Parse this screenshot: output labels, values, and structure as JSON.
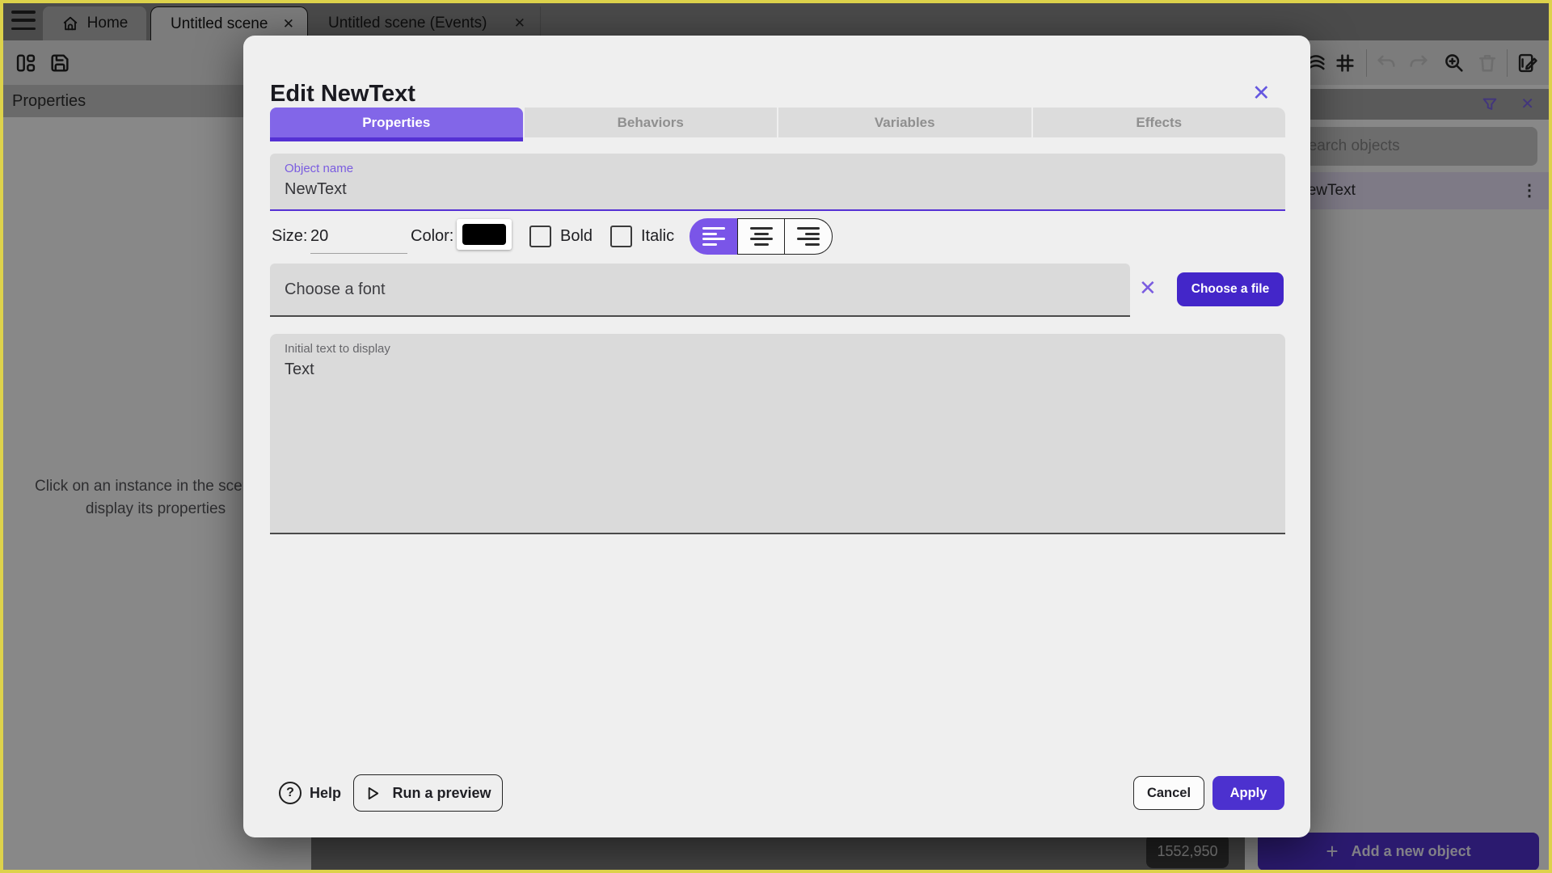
{
  "window": {
    "tabs": [
      {
        "label": "Home"
      },
      {
        "label": "Untitled scene"
      },
      {
        "label": "Untitled scene (Events)"
      }
    ]
  },
  "left_panel": {
    "header": "Properties",
    "hint": "Click on an instance in the scene to display its properties"
  },
  "right_panel": {
    "search_placeholder": "Search objects",
    "object_item": "NewText",
    "add_button_label": "Add a new object"
  },
  "canvas": {
    "coordinates": "1552,950"
  },
  "dialog": {
    "title": "Edit NewText",
    "tabs": [
      {
        "label": "Properties",
        "selected": true
      },
      {
        "label": "Behaviors",
        "selected": false
      },
      {
        "label": "Variables",
        "selected": false
      },
      {
        "label": "Effects",
        "selected": false
      }
    ],
    "object_name": {
      "label": "Object name",
      "value": "NewText"
    },
    "style_row": {
      "size_label": "Size:",
      "size_value": "20",
      "color_label": "Color:",
      "color_value": "#000000",
      "bold_label": "Bold",
      "bold_checked": false,
      "italic_label": "Italic",
      "italic_checked": false,
      "alignment_selected": "left"
    },
    "font": {
      "select_value": "Choose a font",
      "button_label": "Choose a file"
    },
    "initial_text": {
      "label": "Initial text to display",
      "value": "Text"
    },
    "footer": {
      "help_label": "Help",
      "run_preview_label": "Run a preview",
      "cancel_label": "Cancel",
      "apply_label": "Apply"
    }
  },
  "icons": {
    "close": "✕",
    "menu_dots": "⋮",
    "plus": "+",
    "question": "?"
  },
  "colors": {
    "accent_purple": "#4c31cf",
    "selected_tab_purple": "#8266e8",
    "tab_indicator_purple": "#5531d4",
    "label_purple": "#7a5ce0",
    "selection_row_lavender": "#e9e2f7",
    "focus_frame_yellow": "#ddd24b",
    "dialog_background": "#efefef",
    "field_background": "#dadada"
  }
}
